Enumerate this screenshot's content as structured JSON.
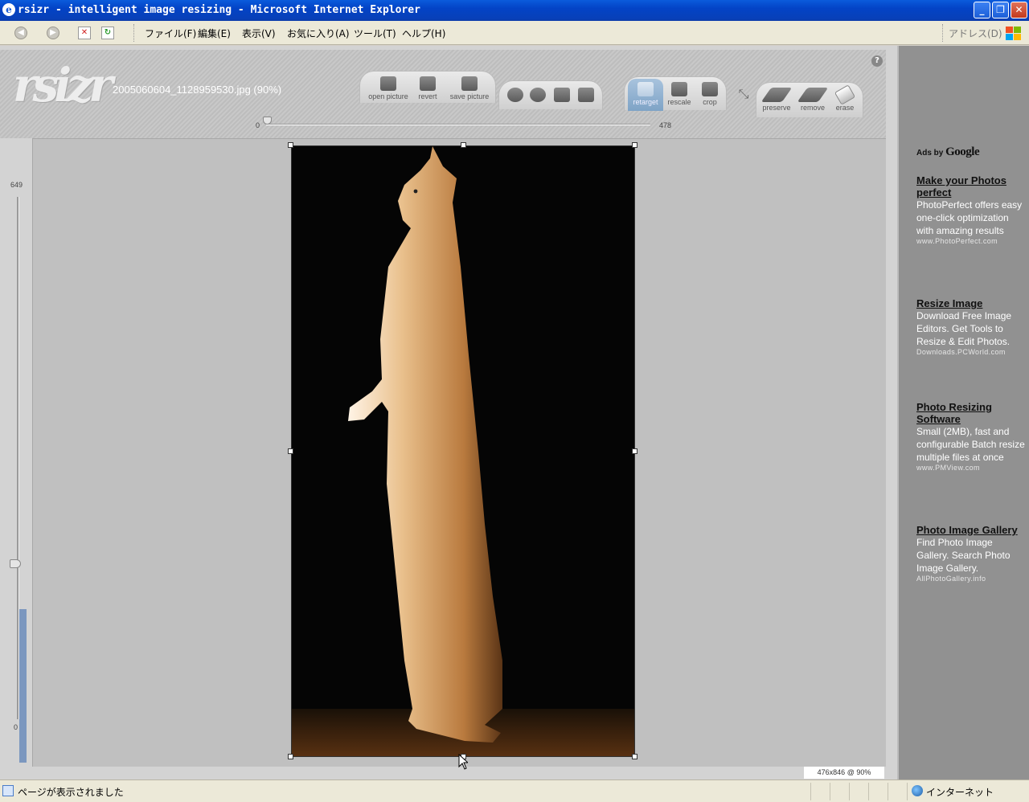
{
  "window": {
    "title": "rsizr - intelligent image resizing - Microsoft Internet Explorer",
    "min_label": "_",
    "max_label": "❐",
    "close_label": "✕"
  },
  "menubar": {
    "items": [
      "ファイル(F)",
      "編集(E)",
      "表示(V)",
      "お気に入り(A)",
      "ツール(T)",
      "ヘルプ(H)"
    ],
    "address_label": "アドレス(D)"
  },
  "app": {
    "logo_text": "rsizr",
    "filename": "2005060604_1128959530.jpg (90%)",
    "help_label": "?",
    "file_tools": [
      {
        "label": "open picture",
        "icon": "folder-open-icon"
      },
      {
        "label": "revert",
        "icon": "revert-arrows-icon"
      },
      {
        "label": "save picture",
        "icon": "floppy-disk-icon"
      }
    ],
    "view_tools": [
      {
        "icon": "zoom-in-icon"
      },
      {
        "icon": "zoom-out-icon"
      },
      {
        "icon": "rotate-left-icon"
      },
      {
        "icon": "rotate-right-icon"
      }
    ],
    "mode_tools": [
      {
        "label": "retarget",
        "icon": "rsizr-retarget-icon",
        "selected": true
      },
      {
        "label": "rescale",
        "icon": "rescale-icon",
        "selected": false
      },
      {
        "label": "crop",
        "icon": "crop-icon",
        "selected": false
      }
    ],
    "expand_icon": "expand-arrows-icon",
    "brush_tools": [
      {
        "label": "preserve",
        "icon": "preserve-brush-icon"
      },
      {
        "label": "remove",
        "icon": "remove-brush-icon"
      },
      {
        "label": "erase",
        "icon": "eraser-icon"
      }
    ],
    "width_slider": {
      "min": "0",
      "max": "478"
    },
    "height_slider": {
      "min": "0",
      "max": "649"
    },
    "size_readout": "476x846 @ 90%"
  },
  "ads": {
    "header_prefix": "Ads by",
    "header_brand": "Google",
    "items": [
      {
        "title": "Make your Photos perfect",
        "body": "PhotoPerfect offers easy one-click optimization with amazing results",
        "url": "www.PhotoPerfect.com"
      },
      {
        "title": "Resize Image",
        "body": "Download Free Image Editors. Get Tools to Resize & Edit Photos.",
        "url": "Downloads.PCWorld.com"
      },
      {
        "title": "Photo Resizing Software",
        "body": "Small (2MB), fast and configurable Batch resize multiple files at once",
        "url": "www.PMView.com"
      },
      {
        "title": "Photo Image Gallery",
        "body": "Find Photo Image Gallery. Search Photo Image Gallery.",
        "url": "AllPhotoGallery.info"
      }
    ]
  },
  "statusbar": {
    "text": "ページが表示されました",
    "zone": "インターネット"
  }
}
